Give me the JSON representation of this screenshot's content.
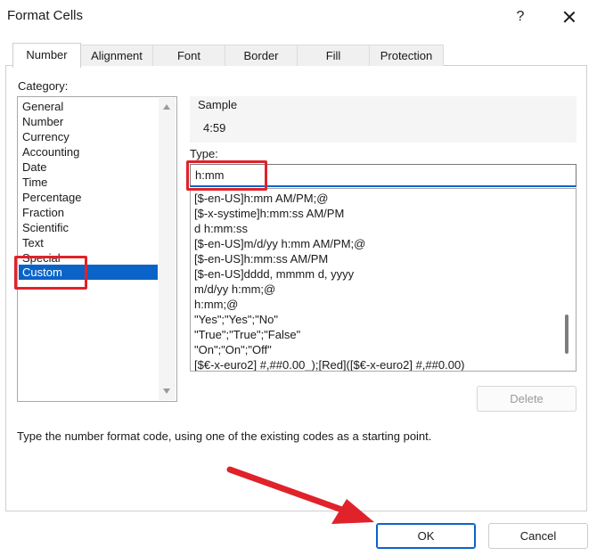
{
  "window": {
    "title": "Format Cells",
    "help_glyph": "?",
    "close": "close-icon"
  },
  "tabs": [
    {
      "label": "Number",
      "active": true
    },
    {
      "label": "Alignment",
      "active": false
    },
    {
      "label": "Font",
      "active": false
    },
    {
      "label": "Border",
      "active": false
    },
    {
      "label": "Fill",
      "active": false
    },
    {
      "label": "Protection",
      "active": false
    }
  ],
  "category": {
    "label": "Category:",
    "items": [
      "General",
      "Number",
      "Currency",
      "Accounting",
      "Date",
      "Time",
      "Percentage",
      "Fraction",
      "Scientific",
      "Text",
      "Special",
      "Custom"
    ],
    "selected": "Custom"
  },
  "sample": {
    "label": "Sample",
    "value": "4:59"
  },
  "type": {
    "label": "Type:",
    "value": "h:mm",
    "formats": [
      "[$-en-US]h:mm AM/PM;@",
      "[$-x-systime]h:mm:ss AM/PM",
      "d h:mm:ss",
      "[$-en-US]m/d/yy h:mm AM/PM;@",
      "[$-en-US]h:mm:ss AM/PM",
      "[$-en-US]dddd, mmmm d, yyyy",
      "m/d/yy h:mm;@",
      "h:mm;@",
      "\"Yes\";\"Yes\";\"No\"",
      "\"True\";\"True\";\"False\"",
      "\"On\";\"On\";\"Off\"",
      "[$€-x-euro2] #,##0.00_);[Red]([$€-x-euro2] #,##0.00)"
    ]
  },
  "buttons": {
    "delete": "Delete",
    "ok": "OK",
    "cancel": "Cancel"
  },
  "hint": "Type the number format code, using one of the existing codes as a starting point.",
  "colors": {
    "accent": "#0a64c8",
    "annotation": "#e0222a"
  }
}
